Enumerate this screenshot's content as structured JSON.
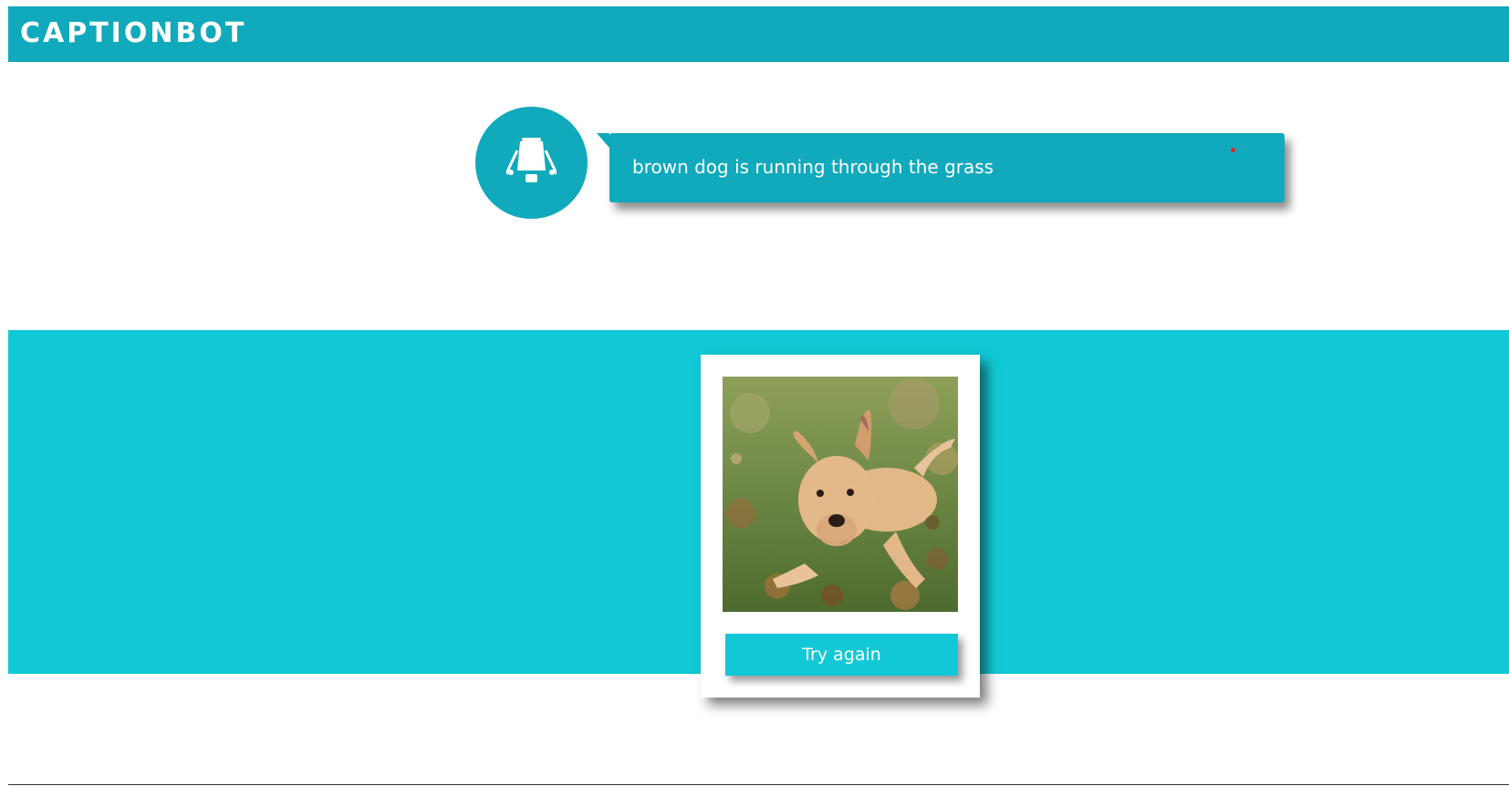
{
  "header": {
    "brand": "CAPTIONBOT"
  },
  "bot": {
    "avatar_icon": "robot-icon",
    "caption": "brown dog is running through the grass"
  },
  "card": {
    "image_alt": "puppy lying in grass and leaves",
    "button_label": "Try again"
  },
  "colors": {
    "header": "#11a9bc",
    "band": "#13c8d6",
    "bubble": "#11a9bc",
    "text": "#ffffff"
  }
}
